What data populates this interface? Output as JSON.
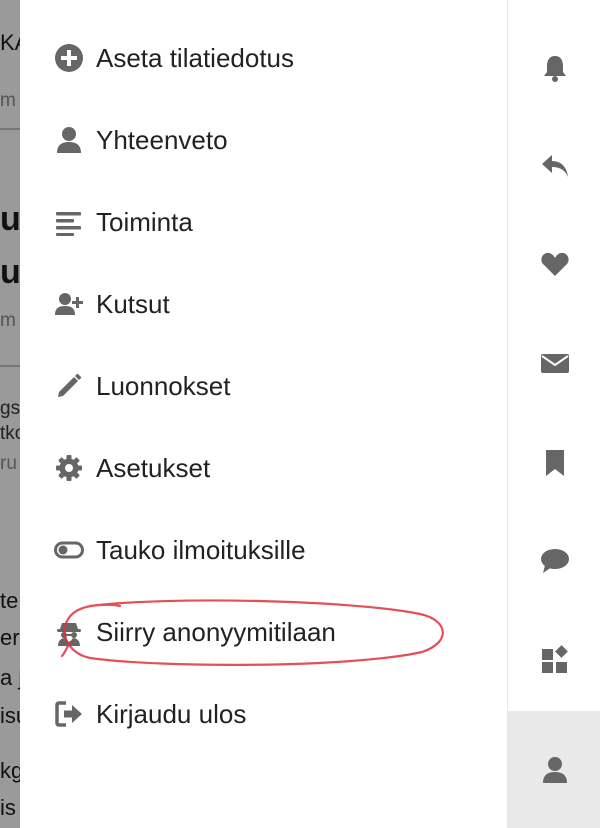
{
  "background": {
    "fragments": [
      "KA",
      "m",
      "u",
      "u",
      "m",
      "gst",
      "tko",
      "ru",
      "te",
      "er",
      "a j",
      "isu",
      "kg",
      "is"
    ]
  },
  "menu": {
    "items": [
      {
        "label": "Aseta tilatiedotus",
        "icon": "plus-circle-icon"
      },
      {
        "label": "Yhteenveto",
        "icon": "user-icon"
      },
      {
        "label": "Toiminta",
        "icon": "list-icon"
      },
      {
        "label": "Kutsut",
        "icon": "user-plus-icon"
      },
      {
        "label": "Luonnokset",
        "icon": "pencil-icon"
      },
      {
        "label": "Asetukset",
        "icon": "gear-icon"
      },
      {
        "label": "Tauko ilmoituksille",
        "icon": "toggle-icon"
      },
      {
        "label": "Siirry anonyymitilaan",
        "icon": "incognito-icon"
      },
      {
        "label": "Kirjaudu ulos",
        "icon": "sign-out-icon"
      }
    ]
  },
  "rail": {
    "items": [
      {
        "icon": "bell-icon",
        "active": false
      },
      {
        "icon": "reply-icon",
        "active": false
      },
      {
        "icon": "heart-icon",
        "active": false
      },
      {
        "icon": "envelope-icon",
        "active": false
      },
      {
        "icon": "bookmark-icon",
        "active": false
      },
      {
        "icon": "comment-icon",
        "active": false
      },
      {
        "icon": "widgets-icon",
        "active": false
      },
      {
        "icon": "user-icon",
        "active": true
      }
    ]
  },
  "colors": {
    "icon": "#666666",
    "text": "#222222",
    "highlight_ring": "#e0303a",
    "rail_active_bg": "#e9e9e9"
  }
}
